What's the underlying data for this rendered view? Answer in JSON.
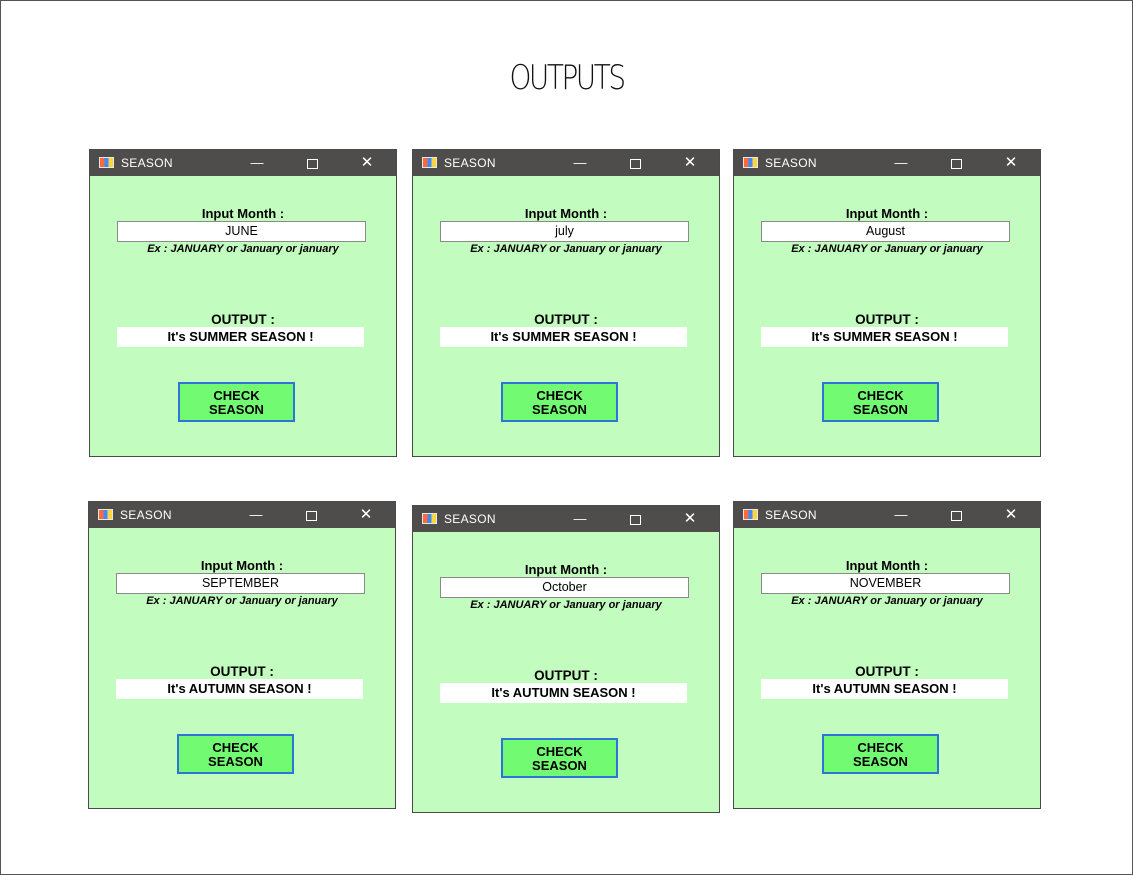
{
  "page_title": "OUTPUTS",
  "windows": [
    {
      "title": "SEASON",
      "input_label": "Input Month :",
      "month": "JUNE",
      "hint": "Ex : JANUARY or January or january",
      "output_label": "OUTPUT :",
      "output": "It's SUMMER SEASON !",
      "button_line1": "CHECK",
      "button_line2": "SEASON",
      "min_glyph": "—",
      "close_glyph": "✕"
    },
    {
      "title": "SEASON",
      "input_label": "Input Month :",
      "month": "july",
      "hint": "Ex : JANUARY or January or january",
      "output_label": "OUTPUT :",
      "output": "It's SUMMER SEASON !",
      "button_line1": "CHECK",
      "button_line2": "SEASON",
      "min_glyph": "—",
      "close_glyph": "✕"
    },
    {
      "title": "SEASON",
      "input_label": "Input Month :",
      "month": "August",
      "hint": "Ex : JANUARY or January or january",
      "output_label": "OUTPUT :",
      "output": "It's SUMMER SEASON !",
      "button_line1": "CHECK",
      "button_line2": "SEASON",
      "min_glyph": "—",
      "close_glyph": "✕"
    },
    {
      "title": "SEASON",
      "input_label": "Input Month :",
      "month": "SEPTEMBER",
      "hint": "Ex : JANUARY or January or january",
      "output_label": "OUTPUT :",
      "output": "It's AUTUMN SEASON !",
      "button_line1": "CHECK",
      "button_line2": "SEASON",
      "min_glyph": "—",
      "close_glyph": "✕"
    },
    {
      "title": "SEASON",
      "input_label": "Input Month :",
      "month": "October",
      "hint": "Ex : JANUARY or January or january",
      "output_label": "OUTPUT :",
      "output": "It's AUTUMN SEASON !",
      "button_line1": "CHECK",
      "button_line2": "SEASON",
      "min_glyph": "—",
      "close_glyph": "✕"
    },
    {
      "title": "SEASON",
      "input_label": "Input Month :",
      "month": "NOVEMBER",
      "hint": "Ex : JANUARY or January or january",
      "output_label": "OUTPUT :",
      "output": "It's AUTUMN SEASON !",
      "button_line1": "CHECK",
      "button_line2": "SEASON",
      "min_glyph": "—",
      "close_glyph": "✕"
    }
  ],
  "colors": {
    "window_background": "#c3fcbf",
    "titlebar": "#4f4d4b",
    "button_fill": "#72fa72",
    "button_border": "#2d74d8"
  },
  "icons": {
    "app": "app-icon",
    "minimize": "minimize-icon",
    "maximize": "maximize-icon",
    "close": "close-icon"
  }
}
